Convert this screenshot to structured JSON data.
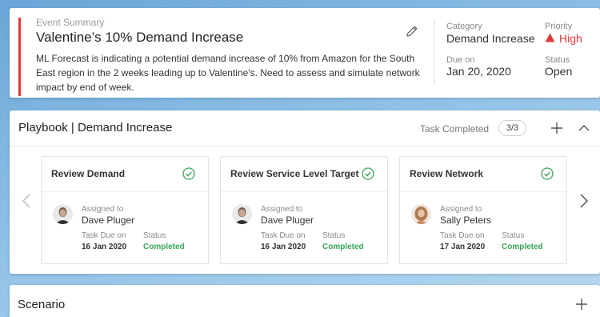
{
  "event": {
    "overline": "Event Summary",
    "title": "Valentine’s 10% Demand Increase",
    "description": "ML Forecast is indicating a potential demand increase of 10% from Amazon for the South East region in the 2 weeks leading up to Valentine's. Need to assess and simulate network impact by end of week.",
    "category_label": "Category",
    "category_value": "Demand Increase",
    "priority_label": "Priority",
    "priority_value": "High",
    "due_label": "Due on",
    "due_value": "Jan 20, 2020",
    "status_label": "Status",
    "status_value": "Open",
    "accent_color": "#e0393e",
    "icons": {
      "edit": "pencil-icon",
      "priority": "warning-triangle-icon"
    }
  },
  "playbook": {
    "title": "Playbook | Demand Increase",
    "task_completed_label": "Task Completed",
    "task_count": "3/3",
    "icons": {
      "add": "plus-icon",
      "collapse": "chevron-up-icon",
      "prev": "chevron-left-icon",
      "next": "chevron-right-icon"
    },
    "tasks": [
      {
        "name": "Review Demand",
        "assigned_label": "Assigned to",
        "assignee": "Dave Pluger",
        "due_label": "Task Due on",
        "due": "16 Jan 2020",
        "status_label": "Status",
        "status": "Completed"
      },
      {
        "name": "Review Service Level Target",
        "assigned_label": "Assigned to",
        "assignee": "Dave Pluger",
        "due_label": "Task Due on",
        "due": "16 Jan 2020",
        "status_label": "Status",
        "status": "Completed"
      },
      {
        "name": "Review Network",
        "assigned_label": "Assigned to",
        "assignee": "Sally Peters",
        "due_label": "Task Due on",
        "due": "17 Jan 2020",
        "status_label": "Status",
        "status": "Completed"
      }
    ],
    "status_color": "#3aa55a"
  },
  "scenario": {
    "title": "Scenario",
    "icons": {
      "add": "plus-icon"
    }
  }
}
